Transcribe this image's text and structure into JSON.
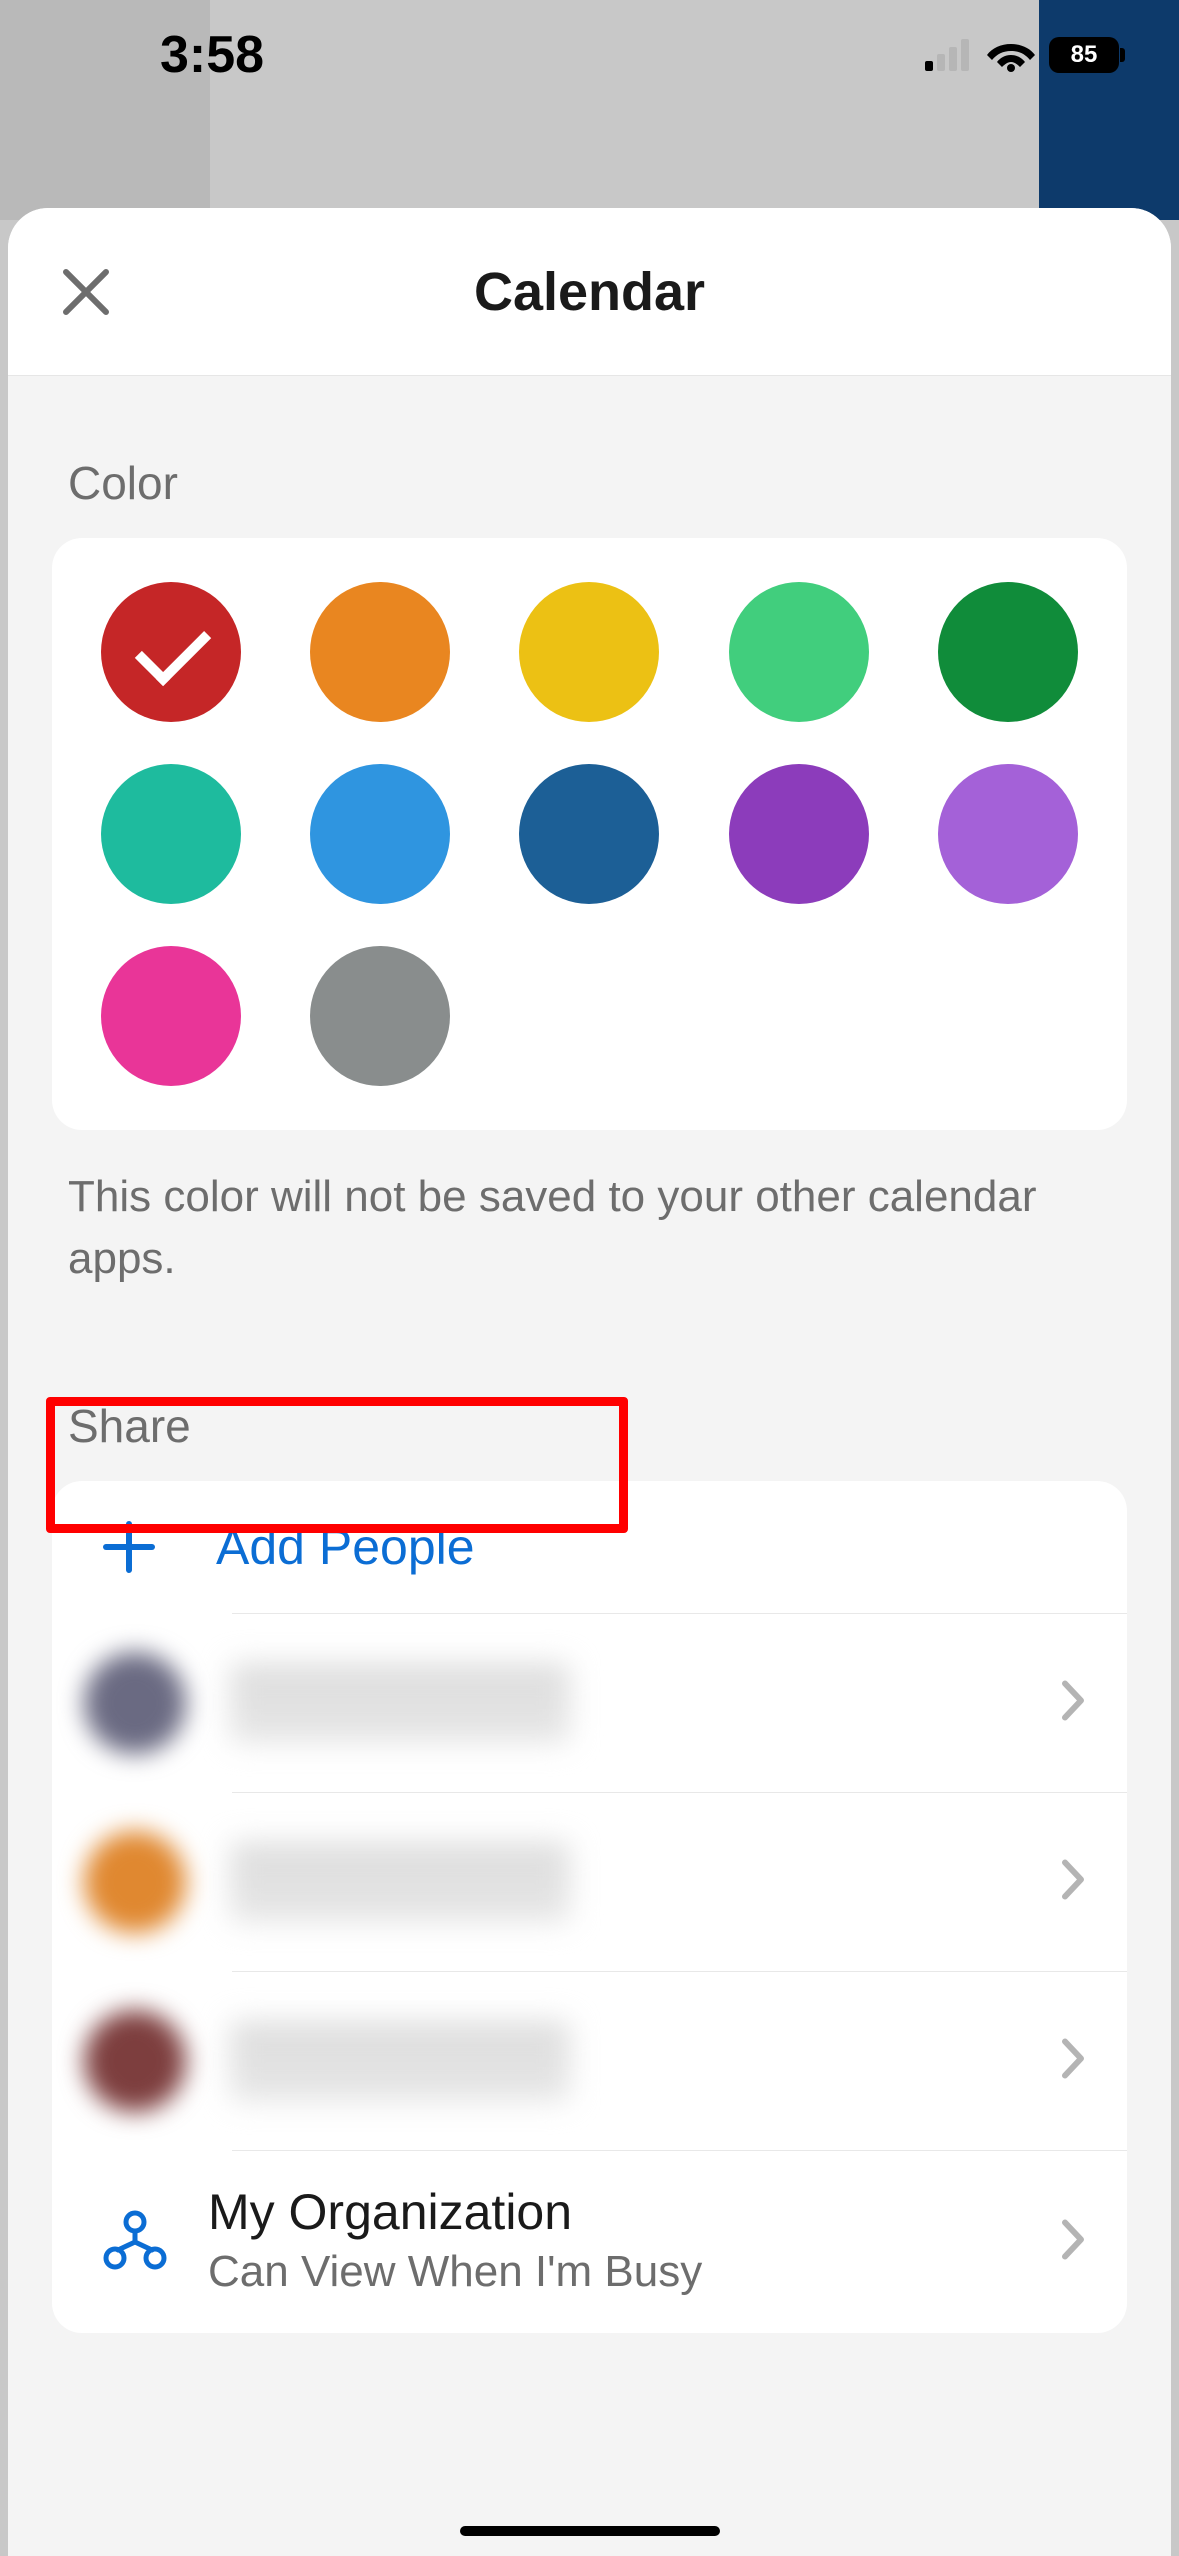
{
  "status": {
    "time": "3:58",
    "battery": "85"
  },
  "header": {
    "title": "Calendar"
  },
  "color_section": {
    "label": "Color",
    "footer": "This color will not be saved to your other calendar apps.",
    "colors": [
      {
        "hex": "#c52627",
        "selected": true,
        "name": "red"
      },
      {
        "hex": "#e98620",
        "selected": false,
        "name": "orange"
      },
      {
        "hex": "#ecc114",
        "selected": false,
        "name": "yellow"
      },
      {
        "hex": "#41ce7d",
        "selected": false,
        "name": "light-green"
      },
      {
        "hex": "#108c3a",
        "selected": false,
        "name": "dark-green"
      },
      {
        "hex": "#1ebb9e",
        "selected": false,
        "name": "teal"
      },
      {
        "hex": "#2f95e0",
        "selected": false,
        "name": "light-blue"
      },
      {
        "hex": "#1c5f96",
        "selected": false,
        "name": "dark-blue"
      },
      {
        "hex": "#8c3cbb",
        "selected": false,
        "name": "purple"
      },
      {
        "hex": "#a461d8",
        "selected": false,
        "name": "light-purple"
      },
      {
        "hex": "#e93598",
        "selected": false,
        "name": "pink"
      },
      {
        "hex": "#898d8d",
        "selected": false,
        "name": "gray"
      }
    ]
  },
  "share_section": {
    "label": "Share",
    "add_label": "Add People",
    "people": [
      {
        "avatar_color": "#6a6a82"
      },
      {
        "avatar_color": "#e08830"
      },
      {
        "avatar_color": "#7d3e3e"
      }
    ],
    "org": {
      "title": "My Organization",
      "subtitle": "Can View When I'm Busy"
    }
  }
}
